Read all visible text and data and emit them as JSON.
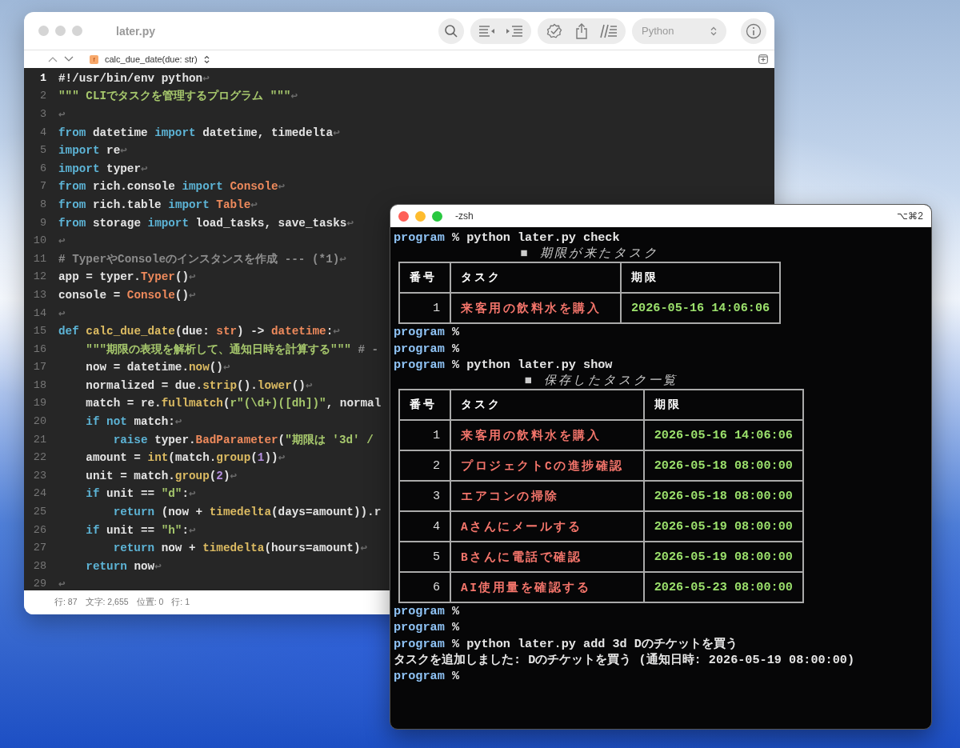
{
  "editor": {
    "title": "later.py",
    "language": "Python",
    "breadcrumb": {
      "icon_letter": "f",
      "symbol": "calc_due_date(due: str)"
    },
    "lines": [
      {
        "number": "1",
        "current": true,
        "tokens": [
          {
            "kind": "plain",
            "text": "#!/usr/bin/env python"
          },
          {
            "kind": "eol",
            "text": "↩"
          }
        ]
      },
      {
        "number": "2",
        "current": false,
        "tokens": [
          {
            "kind": "str",
            "text": "\"\"\" CLIでタスクを管理するプログラム \"\"\""
          },
          {
            "kind": "eol",
            "text": "↩"
          }
        ]
      },
      {
        "number": "3",
        "current": false,
        "tokens": [
          {
            "kind": "eol",
            "text": "↩"
          }
        ]
      },
      {
        "number": "4",
        "current": false,
        "tokens": [
          {
            "kind": "kw",
            "text": "from"
          },
          {
            "kind": "plain",
            "text": " datetime "
          },
          {
            "kind": "kw",
            "text": "import"
          },
          {
            "kind": "plain",
            "text": " datetime, timedelta"
          },
          {
            "kind": "eol",
            "text": "↩"
          }
        ]
      },
      {
        "number": "5",
        "current": false,
        "tokens": [
          {
            "kind": "kw",
            "text": "import"
          },
          {
            "kind": "plain",
            "text": " re"
          },
          {
            "kind": "eol",
            "text": "↩"
          }
        ]
      },
      {
        "number": "6",
        "current": false,
        "tokens": [
          {
            "kind": "kw",
            "text": "import"
          },
          {
            "kind": "plain",
            "text": " typer"
          },
          {
            "kind": "eol",
            "text": "↩"
          }
        ]
      },
      {
        "number": "7",
        "current": false,
        "tokens": [
          {
            "kind": "kw",
            "text": "from"
          },
          {
            "kind": "plain",
            "text": " rich.console "
          },
          {
            "kind": "kw",
            "text": "import "
          },
          {
            "kind": "cls",
            "text": "Console"
          },
          {
            "kind": "eol",
            "text": "↩"
          }
        ]
      },
      {
        "number": "8",
        "current": false,
        "tokens": [
          {
            "kind": "kw",
            "text": "from"
          },
          {
            "kind": "plain",
            "text": " rich.table "
          },
          {
            "kind": "kw",
            "text": "import "
          },
          {
            "kind": "cls",
            "text": "Table"
          },
          {
            "kind": "eol",
            "text": "↩"
          }
        ]
      },
      {
        "number": "9",
        "current": false,
        "tokens": [
          {
            "kind": "kw",
            "text": "from"
          },
          {
            "kind": "plain",
            "text": " storage "
          },
          {
            "kind": "kw",
            "text": "import"
          },
          {
            "kind": "plain",
            "text": " load_tasks, save_tasks"
          },
          {
            "kind": "eol",
            "text": "↩"
          }
        ]
      },
      {
        "number": "10",
        "current": false,
        "tokens": [
          {
            "kind": "eol",
            "text": "↩"
          }
        ]
      },
      {
        "number": "11",
        "current": false,
        "tokens": [
          {
            "kind": "comment",
            "text": "# TyperやConsoleのインスタンスを作成 --- (*1)"
          },
          {
            "kind": "eol",
            "text": "↩"
          }
        ]
      },
      {
        "number": "12",
        "current": false,
        "tokens": [
          {
            "kind": "plain",
            "text": "app = typer."
          },
          {
            "kind": "cls",
            "text": "Typer"
          },
          {
            "kind": "plain",
            "text": "()"
          },
          {
            "kind": "eol",
            "text": "↩"
          }
        ]
      },
      {
        "number": "13",
        "current": false,
        "tokens": [
          {
            "kind": "plain",
            "text": "console = "
          },
          {
            "kind": "cls",
            "text": "Console"
          },
          {
            "kind": "plain",
            "text": "()"
          },
          {
            "kind": "eol",
            "text": "↩"
          }
        ]
      },
      {
        "number": "14",
        "current": false,
        "tokens": [
          {
            "kind": "eol",
            "text": "↩"
          }
        ]
      },
      {
        "number": "15",
        "current": false,
        "tokens": [
          {
            "kind": "kw",
            "text": "def "
          },
          {
            "kind": "fn",
            "text": "calc_due_date"
          },
          {
            "kind": "plain",
            "text": "(due: "
          },
          {
            "kind": "cls",
            "text": "str"
          },
          {
            "kind": "plain",
            "text": ") -> "
          },
          {
            "kind": "cls",
            "text": "datetime"
          },
          {
            "kind": "plain",
            "text": ":"
          },
          {
            "kind": "eol",
            "text": "↩"
          }
        ]
      },
      {
        "number": "16",
        "current": false,
        "tokens": [
          {
            "kind": "str",
            "text": "    \"\"\"期限の表現を解析して、通知日時を計算する\"\"\" "
          },
          {
            "kind": "comment",
            "text": "# -"
          }
        ]
      },
      {
        "number": "17",
        "current": false,
        "tokens": [
          {
            "kind": "plain",
            "text": "    now = datetime."
          },
          {
            "kind": "fn",
            "text": "now"
          },
          {
            "kind": "plain",
            "text": "()"
          },
          {
            "kind": "eol",
            "text": "↩"
          }
        ]
      },
      {
        "number": "18",
        "current": false,
        "tokens": [
          {
            "kind": "plain",
            "text": "    normalized = due."
          },
          {
            "kind": "fn",
            "text": "strip"
          },
          {
            "kind": "plain",
            "text": "()."
          },
          {
            "kind": "fn",
            "text": "lower"
          },
          {
            "kind": "plain",
            "text": "()"
          },
          {
            "kind": "eol",
            "text": "↩"
          }
        ]
      },
      {
        "number": "19",
        "current": false,
        "tokens": [
          {
            "kind": "plain",
            "text": "    match = re."
          },
          {
            "kind": "fn",
            "text": "fullmatch"
          },
          {
            "kind": "plain",
            "text": "("
          },
          {
            "kind": "str",
            "text": "r\"(\\d+)([dh])\""
          },
          {
            "kind": "plain",
            "text": ", normal"
          }
        ]
      },
      {
        "number": "20",
        "current": false,
        "tokens": [
          {
            "kind": "kw",
            "text": "    if not"
          },
          {
            "kind": "plain",
            "text": " match:"
          },
          {
            "kind": "eol",
            "text": "↩"
          }
        ]
      },
      {
        "number": "21",
        "current": false,
        "tokens": [
          {
            "kind": "kw",
            "text": "        raise"
          },
          {
            "kind": "plain",
            "text": " typer."
          },
          {
            "kind": "cls",
            "text": "BadParameter"
          },
          {
            "kind": "plain",
            "text": "("
          },
          {
            "kind": "str",
            "text": "\"期限は '3d' /"
          }
        ]
      },
      {
        "number": "22",
        "current": false,
        "tokens": [
          {
            "kind": "plain",
            "text": "    amount = "
          },
          {
            "kind": "fn",
            "text": "int"
          },
          {
            "kind": "plain",
            "text": "(match."
          },
          {
            "kind": "fn",
            "text": "group"
          },
          {
            "kind": "plain",
            "text": "("
          },
          {
            "kind": "num",
            "text": "1"
          },
          {
            "kind": "plain",
            "text": "))"
          },
          {
            "kind": "eol",
            "text": "↩"
          }
        ]
      },
      {
        "number": "23",
        "current": false,
        "tokens": [
          {
            "kind": "plain",
            "text": "    unit = match."
          },
          {
            "kind": "fn",
            "text": "group"
          },
          {
            "kind": "plain",
            "text": "("
          },
          {
            "kind": "num",
            "text": "2"
          },
          {
            "kind": "plain",
            "text": ")"
          },
          {
            "kind": "eol",
            "text": "↩"
          }
        ]
      },
      {
        "number": "24",
        "current": false,
        "tokens": [
          {
            "kind": "kw",
            "text": "    if"
          },
          {
            "kind": "plain",
            "text": " unit == "
          },
          {
            "kind": "str",
            "text": "\"d\""
          },
          {
            "kind": "plain",
            "text": ":"
          },
          {
            "kind": "eol",
            "text": "↩"
          }
        ]
      },
      {
        "number": "25",
        "current": false,
        "tokens": [
          {
            "kind": "kw",
            "text": "        return"
          },
          {
            "kind": "plain",
            "text": " (now + "
          },
          {
            "kind": "fn",
            "text": "timedelta"
          },
          {
            "kind": "plain",
            "text": "(days=amount)).r"
          }
        ]
      },
      {
        "number": "26",
        "current": false,
        "tokens": [
          {
            "kind": "kw",
            "text": "    if"
          },
          {
            "kind": "plain",
            "text": " unit == "
          },
          {
            "kind": "str",
            "text": "\"h\""
          },
          {
            "kind": "plain",
            "text": ":"
          },
          {
            "kind": "eol",
            "text": "↩"
          }
        ]
      },
      {
        "number": "27",
        "current": false,
        "tokens": [
          {
            "kind": "kw",
            "text": "        return"
          },
          {
            "kind": "plain",
            "text": " now + "
          },
          {
            "kind": "fn",
            "text": "timedelta"
          },
          {
            "kind": "plain",
            "text": "(hours=amount)"
          },
          {
            "kind": "eol",
            "text": "↩"
          }
        ]
      },
      {
        "number": "28",
        "current": false,
        "tokens": [
          {
            "kind": "kw",
            "text": "    return"
          },
          {
            "kind": "plain",
            "text": " now"
          },
          {
            "kind": "eol",
            "text": "↩"
          }
        ]
      },
      {
        "number": "29",
        "current": false,
        "tokens": [
          {
            "kind": "eol",
            "text": "↩"
          }
        ]
      }
    ],
    "status_bar": [
      "行: 87",
      "文字: 2,655",
      "位置: 0",
      "行: 1"
    ]
  },
  "terminal": {
    "title": "-zsh",
    "shortcut": "⌥⌘2",
    "lines": [
      {
        "kind": "prompt",
        "user": "program",
        "symbol": "%",
        "command": "python later.py check"
      },
      {
        "kind": "table",
        "title": "■ 期限が来たタスク",
        "columns": [
          "番号",
          "タスク",
          "期限"
        ],
        "rows": [
          [
            "1",
            "来客用の飲料水を購入",
            "2026-05-16 14:06:06"
          ]
        ]
      },
      {
        "kind": "prompt",
        "user": "program",
        "symbol": "%"
      },
      {
        "kind": "prompt",
        "user": "program",
        "symbol": "%"
      },
      {
        "kind": "prompt",
        "user": "program",
        "symbol": "%",
        "command": "python later.py show"
      },
      {
        "kind": "table",
        "title": "■ 保存したタスク一覧",
        "columns": [
          "番号",
          "タスク",
          "期限"
        ],
        "rows": [
          [
            "1",
            "来客用の飲料水を購入",
            "2026-05-16 14:06:06"
          ],
          [
            "2",
            "プロジェクトCの進捗確認",
            "2026-05-18 08:00:00"
          ],
          [
            "3",
            "エアコンの掃除",
            "2026-05-18 08:00:00"
          ],
          [
            "4",
            "Aさんにメールする",
            "2026-05-19 08:00:00"
          ],
          [
            "5",
            "Bさんに電話で確認",
            "2026-05-19 08:00:00"
          ],
          [
            "6",
            "AI使用量を確認する",
            "2026-05-23 08:00:00"
          ]
        ]
      },
      {
        "kind": "prompt",
        "user": "program",
        "symbol": "%"
      },
      {
        "kind": "prompt",
        "user": "program",
        "symbol": "%"
      },
      {
        "kind": "prompt",
        "user": "program",
        "symbol": "%",
        "command": "python later.py add 3d Dのチケットを買う"
      },
      {
        "kind": "output",
        "text": "タスクを追加しました: Dのチケットを買う (通知日時: 2026-05-19 08:00:00)"
      },
      {
        "kind": "prompt",
        "user": "program",
        "symbol": "%"
      }
    ]
  }
}
